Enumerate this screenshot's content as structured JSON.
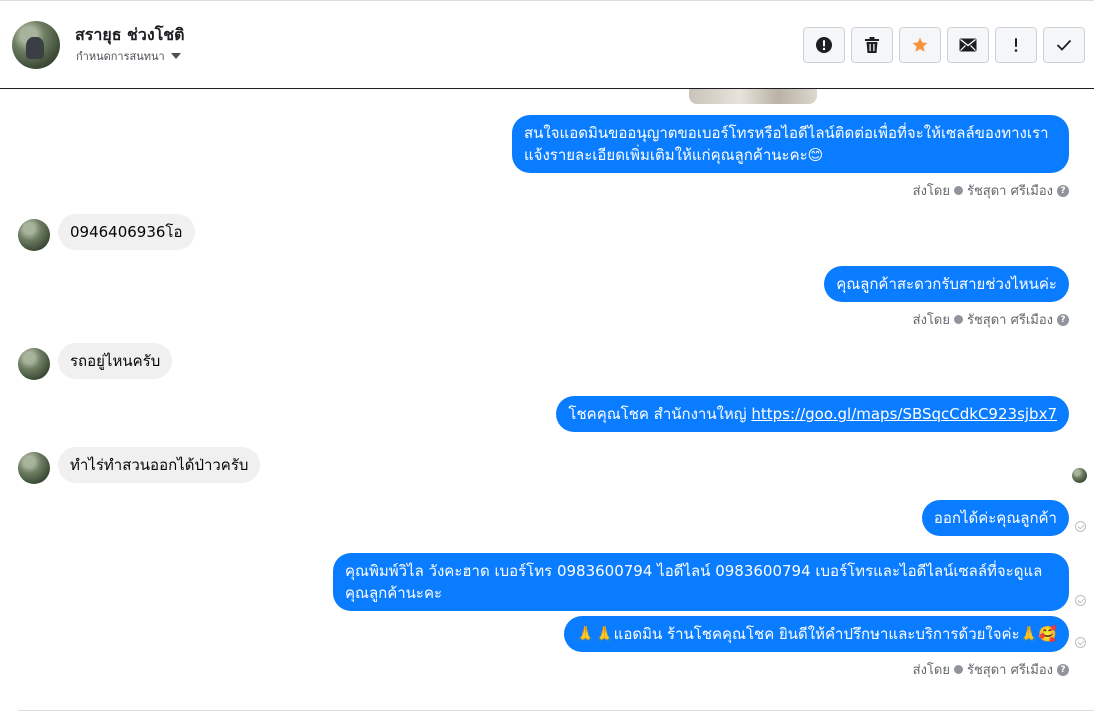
{
  "header": {
    "contact_name": "สรายุธ ช่วงโชติ",
    "assign_label": "กำหนดการสนทนา",
    "toolbar": [
      {
        "icon": "alert-circle-icon",
        "name": "mark-spam-button"
      },
      {
        "icon": "trash-icon",
        "name": "delete-button"
      },
      {
        "icon": "star-icon",
        "name": "star-button",
        "color": "#f7923b"
      },
      {
        "icon": "envelope-icon",
        "name": "mark-unread-button"
      },
      {
        "icon": "exclamation-icon",
        "name": "follow-up-button"
      },
      {
        "icon": "checkmark-icon",
        "name": "mark-done-button"
      }
    ]
  },
  "colors": {
    "outgoing_bubble": "#0a7cff",
    "incoming_bubble": "#f0f0f0",
    "star": "#f7923b"
  },
  "messages": {
    "m1_line1": "สนใจแอดมินขออนุญาตขอเบอร์โทรหรือไอดีไลน์ติดต่อเพื่อที่จะให้เซลล์ของทางเรา",
    "m1_line2": "แจ้งรายละเอียดเพิ่มเติมให้แก่คุณลูกค้านะคะ😊",
    "m2": "0946406936โอ",
    "m3": "คุณลูกค้าสะดวกรับสายช่วงไหนค่ะ",
    "m4": "รถอยู่ไหนครับ",
    "m5_text": "โชคคุณโชค สำนักงานใหญ่ ",
    "m5_link": "https://goo.gl/maps/SBSqcCdkC923sjbx7",
    "m6": "ทำไร่ทำสวนออกได้ป่าวครับ",
    "m7": "ออกได้ค่ะคุณลูกค้า",
    "m8_line1": "คุณพิมพ์วิไล วังคะฮาด   เบอร์โทร 0983600794  ไอดีไลน์ 0983600794   เบอร์โทรและไอดีไลน์เซลล์ที่จะดูแล",
    "m8_line2": "คุณลูกค้านะคะ",
    "m9": "🙏🙏แอดมิน ร้านโชคคุณโชค ยินดีให้คำปรึกษาและบริการด้วยใจค่ะ🙏🥰"
  },
  "sent_by": {
    "prefix": "ส่งโดย",
    "agent": "รัชสุดา ศรีเมือง",
    "help": "?"
  }
}
